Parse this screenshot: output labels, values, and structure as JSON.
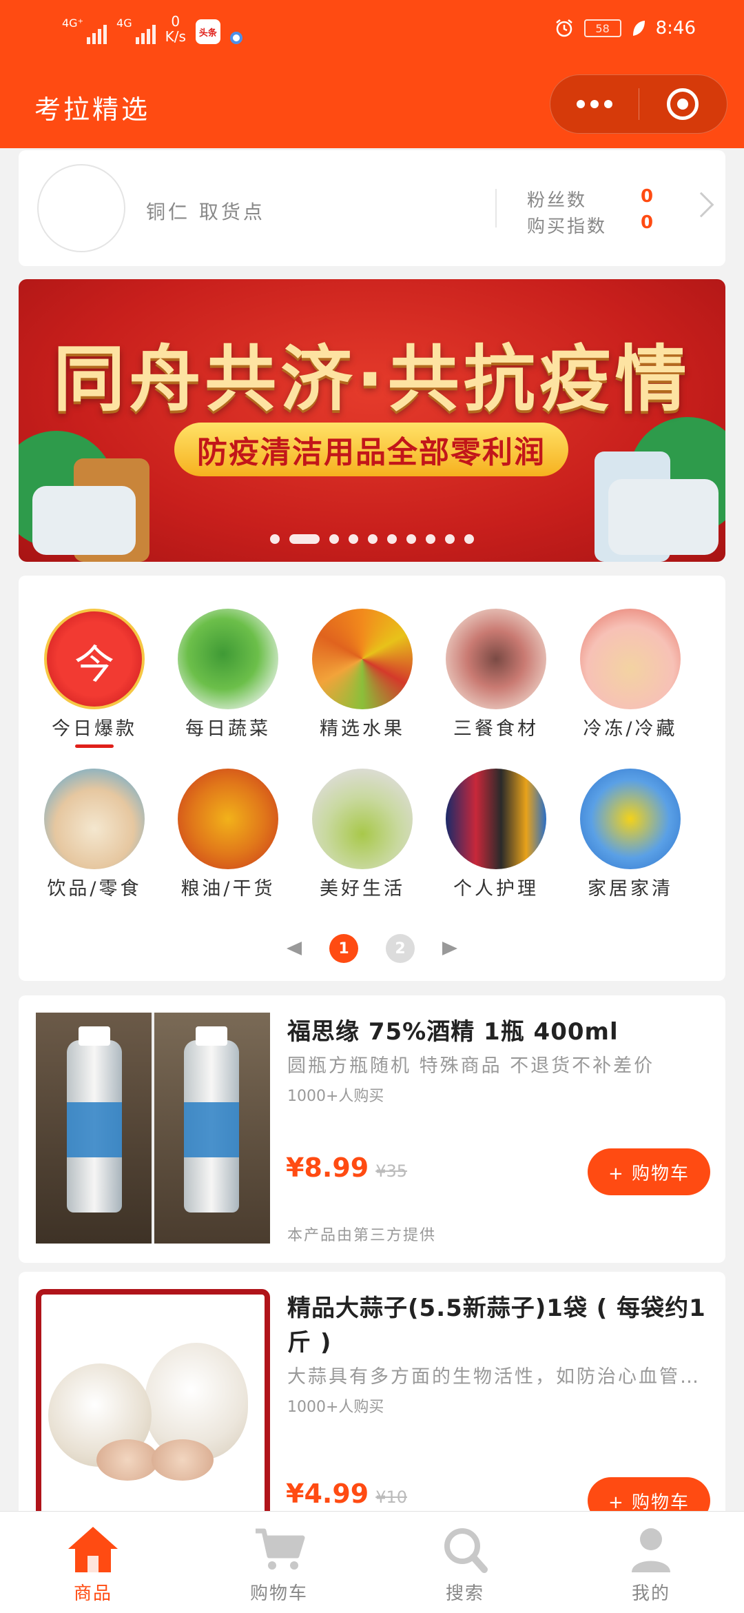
{
  "status_bar": {
    "network1": "4G⁺",
    "network2": "4G",
    "speed_value": "0",
    "speed_unit": "K/s",
    "app_badge": "头条",
    "battery": "58",
    "time": "8:46"
  },
  "nav": {
    "title": "考拉精选"
  },
  "profile": {
    "pickup_point": "铜仁 取货点",
    "fans_label": "粉丝数",
    "fans_value": "0",
    "purchase_label": "购买指数",
    "purchase_value": "0"
  },
  "banner": {
    "headline": "同舟共济·共抗疫情",
    "subline": "防疫清洁用品全部零利润",
    "slide_count": 10,
    "active_slide": 1
  },
  "categories": [
    {
      "label": "今日爆款",
      "icon": "lantern-icon",
      "glyph": "今"
    },
    {
      "label": "每日蔬菜",
      "icon": "vegetables-icon"
    },
    {
      "label": "精选水果",
      "icon": "fruit-icon"
    },
    {
      "label": "三餐食材",
      "icon": "meat-icon"
    },
    {
      "label": "冷冻/冷藏",
      "icon": "frozen-food-icon"
    },
    {
      "label": "饮品/零食",
      "icon": "snacks-icon"
    },
    {
      "label": "粮油/干货",
      "icon": "grain-oil-icon"
    },
    {
      "label": "美好生活",
      "icon": "home-goods-icon"
    },
    {
      "label": "个人护理",
      "icon": "personal-care-icon"
    },
    {
      "label": "家居家清",
      "icon": "cleaning-icon"
    }
  ],
  "category_pager": {
    "pages": [
      "1",
      "2"
    ],
    "current": "1"
  },
  "products": [
    {
      "name": "福思缘 75%酒精 1瓶 400ml",
      "desc": "圆瓶方瓶随机 特殊商品 不退货不补差价",
      "sold": "1000+人购买",
      "price": "¥8.99",
      "old_price": "¥35",
      "button": "+ 购物车",
      "note": "本产品由第三方提供"
    },
    {
      "name": "精品大蒜子(5.5新蒜子)1袋 ( 每袋约1斤 )",
      "desc": "大蒜具有多方面的生物活性，如防治心血管疾病",
      "sold": "1000+人购买",
      "price": "¥4.99",
      "old_price": "¥10",
      "button": "+ 购物车"
    }
  ],
  "tabbar": [
    {
      "label": "商品",
      "icon": "home-icon",
      "active": true
    },
    {
      "label": "购物车",
      "icon": "cart-icon",
      "active": false
    },
    {
      "label": "搜索",
      "icon": "search-icon",
      "active": false
    },
    {
      "label": "我的",
      "icon": "user-icon",
      "active": false
    }
  ],
  "colors": {
    "brand": "#ff4b12",
    "background": "#f2f2f2"
  }
}
